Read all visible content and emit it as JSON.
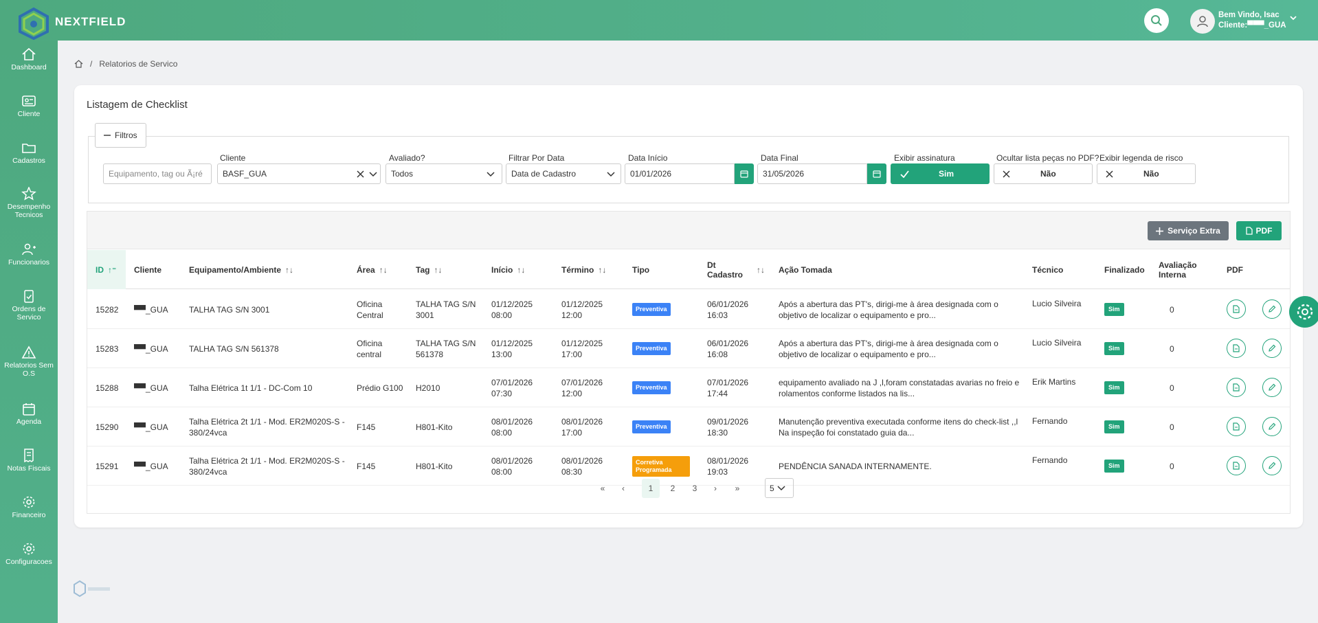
{
  "app": {
    "brand": "NEXTFIELD"
  },
  "user": {
    "greeting": "Bem Vindo, Isac",
    "client": "Cliente:▀▀▀_GUA"
  },
  "sidebar": {
    "items": [
      {
        "label": "Dashboard",
        "icon": "home-icon"
      },
      {
        "label": "Cliente",
        "icon": "id-card-icon"
      },
      {
        "label": "Cadastros",
        "icon": "folder-icon"
      },
      {
        "label": "Desempenho Tecnicos",
        "icon": "star-icon"
      },
      {
        "label": "Funcionarios",
        "icon": "user-plus-icon"
      },
      {
        "label": "Ordens de Servico",
        "icon": "clipboard-check-icon"
      },
      {
        "label": "Relatorios Sem O.S",
        "icon": "warning-icon"
      },
      {
        "label": "Agenda",
        "icon": "calendar-icon"
      },
      {
        "label": "Notas Fiscais",
        "icon": "receipt-icon"
      },
      {
        "label": "Financeiro",
        "icon": "gear-icon"
      },
      {
        "label": "Configuracoes",
        "icon": "gear-icon"
      }
    ]
  },
  "breadcrumb": {
    "separator": "/",
    "current": "Relatorios de Servico"
  },
  "page": {
    "title": "Listagem de Checklist"
  },
  "filters": {
    "legend": "Filtros",
    "search_placeholder": "Equipamento, tag ou Ã¡ré",
    "cliente": {
      "label": "Cliente",
      "value": "BASF_GUA"
    },
    "avaliado": {
      "label": "Avaliado?",
      "value": "Todos"
    },
    "filtrar_data": {
      "label": "Filtrar Por Data",
      "value": "Data de Cadastro"
    },
    "data_inicio": {
      "label": "Data Início",
      "value": "01/01/2026"
    },
    "data_final": {
      "label": "Data Final",
      "value": "31/05/2026"
    },
    "exibir_assinatura": {
      "label": "Exibir assinatura",
      "value": "Sim"
    },
    "ocultar_pecas": {
      "label": "Ocultar lista peças no PDF?",
      "value": "Não"
    },
    "legenda_risco": {
      "label": "Exibir legenda de risco",
      "value": "Não"
    }
  },
  "toolbar": {
    "extra_label": "Serviço Extra",
    "pdf_label": "PDF"
  },
  "table": {
    "headers": {
      "id": "ID",
      "cliente": "Cliente",
      "equipamento": "Equipamento/Ambiente",
      "area": "Área",
      "tag": "Tag",
      "inicio": "Início",
      "termino": "Término",
      "tipo": "Tipo",
      "dt_cadastro": "Dt Cadastro",
      "acao": "Ação Tomada",
      "tecnico": "Técnico",
      "finalizado": "Finalizado",
      "avaliacao": "Avaliação Interna",
      "pdf": "PDF"
    },
    "rows": [
      {
        "id": "15282",
        "cliente": "▀▀_GUA",
        "equipamento": "TALHA TAG S/N 3001",
        "area": "Oficina Central",
        "tag": "TALHA TAG S/N 3001",
        "inicio": "01/12/2025 08:00",
        "termino": "01/12/2025 12:00",
        "tipo": "Preventiva",
        "dt_cadastro": "06/01/2026 16:03",
        "acao": "Após a abertura das PT's, dirigi-me à área designada com o objetivo de localizar o equipamento e pro...",
        "tecnico": "Lucio Silveira",
        "finalizado": "Sim",
        "avaliacao": "0"
      },
      {
        "id": "15283",
        "cliente": "▀▀_GUA",
        "equipamento": "TALHA TAG S/N 561378",
        "area": "Oficina central",
        "tag": "TALHA TAG S/N 561378",
        "inicio": "01/12/2025 13:00",
        "termino": "01/12/2025 17:00",
        "tipo": "Preventiva",
        "dt_cadastro": "06/01/2026 16:08",
        "acao": "Após a abertura das PT's, dirigi-me à área designada com o objetivo de localizar o equipamento e pro...",
        "tecnico": "Lucio Silveira",
        "finalizado": "Sim",
        "avaliacao": "0"
      },
      {
        "id": "15288",
        "cliente": "▀▀_GUA",
        "equipamento": "Talha Elétrica 1t 1/1 - DC-Com 10",
        "area": "Prédio G100",
        "tag": "H2010",
        "inicio": "07/01/2026 07:30",
        "termino": "07/01/2026 12:00",
        "tipo": "Preventiva",
        "dt_cadastro": "07/01/2026 17:44",
        "acao": "equipamento avaliado na J ,l,foram constatadas avarias no freio e rolamentos conforme listados na lis...",
        "tecnico": "Erik Martins",
        "finalizado": "Sim",
        "avaliacao": "0"
      },
      {
        "id": "15290",
        "cliente": "▀▀_GUA",
        "equipamento": "Talha Elétrica 2t 1/1 - Mod. ER2M020S-S - 380/24vca",
        "area": "F145",
        "tag": "H801-Kito",
        "inicio": "08/01/2026 08:00",
        "termino": "08/01/2026 17:00",
        "tipo": "Preventiva",
        "dt_cadastro": "09/01/2026 18:30",
        "acao": "Manutenção preventiva executada conforme itens do check-list ,,l Na inspeção foi constatado guia da...",
        "tecnico": "Fernando",
        "finalizado": "Sim",
        "avaliacao": "0"
      },
      {
        "id": "15291",
        "cliente": "▀▀_GUA",
        "equipamento": "Talha Elétrica 2t 1/1 - Mod. ER2M020S-S - 380/24vca",
        "area": "F145",
        "tag": "H801-Kito",
        "inicio": "08/01/2026 08:00",
        "termino": "08/01/2026 08:30",
        "tipo": "Corretiva Programada",
        "dt_cadastro": "08/01/2026 19:03",
        "acao": "PENDÊNCIA SANADA INTERNAMENTE.",
        "tecnico": "Fernando",
        "finalizado": "Sim",
        "avaliacao": "0"
      }
    ]
  },
  "pagination": {
    "first": "«",
    "prev": "‹",
    "pages": [
      "1",
      "2",
      "3"
    ],
    "next": "›",
    "last": "»",
    "page_size": "5"
  },
  "colors": {
    "primary": "#22a37a",
    "header_green": "#4ea97f",
    "badge_blue": "#3b82f6",
    "badge_orange": "#f59e0b",
    "btn_gray": "#6c757d"
  }
}
